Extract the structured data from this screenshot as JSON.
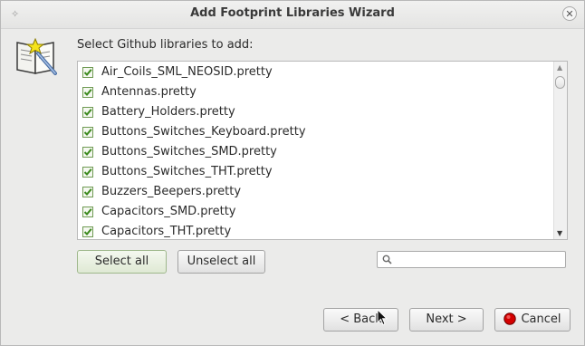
{
  "window": {
    "title": "Add Footprint Libraries Wizard",
    "title_left_glyph": "✧",
    "close_glyph": "✕"
  },
  "prompt": "Select Github libraries to add:",
  "libraries": [
    {
      "label": "Air_Coils_SML_NEOSID.pretty",
      "checked": true
    },
    {
      "label": "Antennas.pretty",
      "checked": true
    },
    {
      "label": "Battery_Holders.pretty",
      "checked": true
    },
    {
      "label": "Buttons_Switches_Keyboard.pretty",
      "checked": true
    },
    {
      "label": "Buttons_Switches_SMD.pretty",
      "checked": true
    },
    {
      "label": "Buttons_Switches_THT.pretty",
      "checked": true
    },
    {
      "label": "Buzzers_Beepers.pretty",
      "checked": true
    },
    {
      "label": "Capacitors_SMD.pretty",
      "checked": true
    },
    {
      "label": "Capacitors_THT.pretty",
      "checked": true
    }
  ],
  "scroll": {
    "up_glyph": "▲",
    "down_glyph": "▼"
  },
  "buttons": {
    "select_all": "Select all",
    "unselect_all": "Unselect all",
    "back": "< Back",
    "next": "Next >",
    "cancel": "Cancel"
  },
  "search": {
    "placeholder": "",
    "value": ""
  },
  "colors": {
    "check_green": "#3c8a1e",
    "cancel_red": "#d40000",
    "accent_border": "#9fb88c"
  },
  "icons": {
    "wizard": "book-wand-icon",
    "search": "search-icon",
    "cancel": "cancel-icon"
  }
}
